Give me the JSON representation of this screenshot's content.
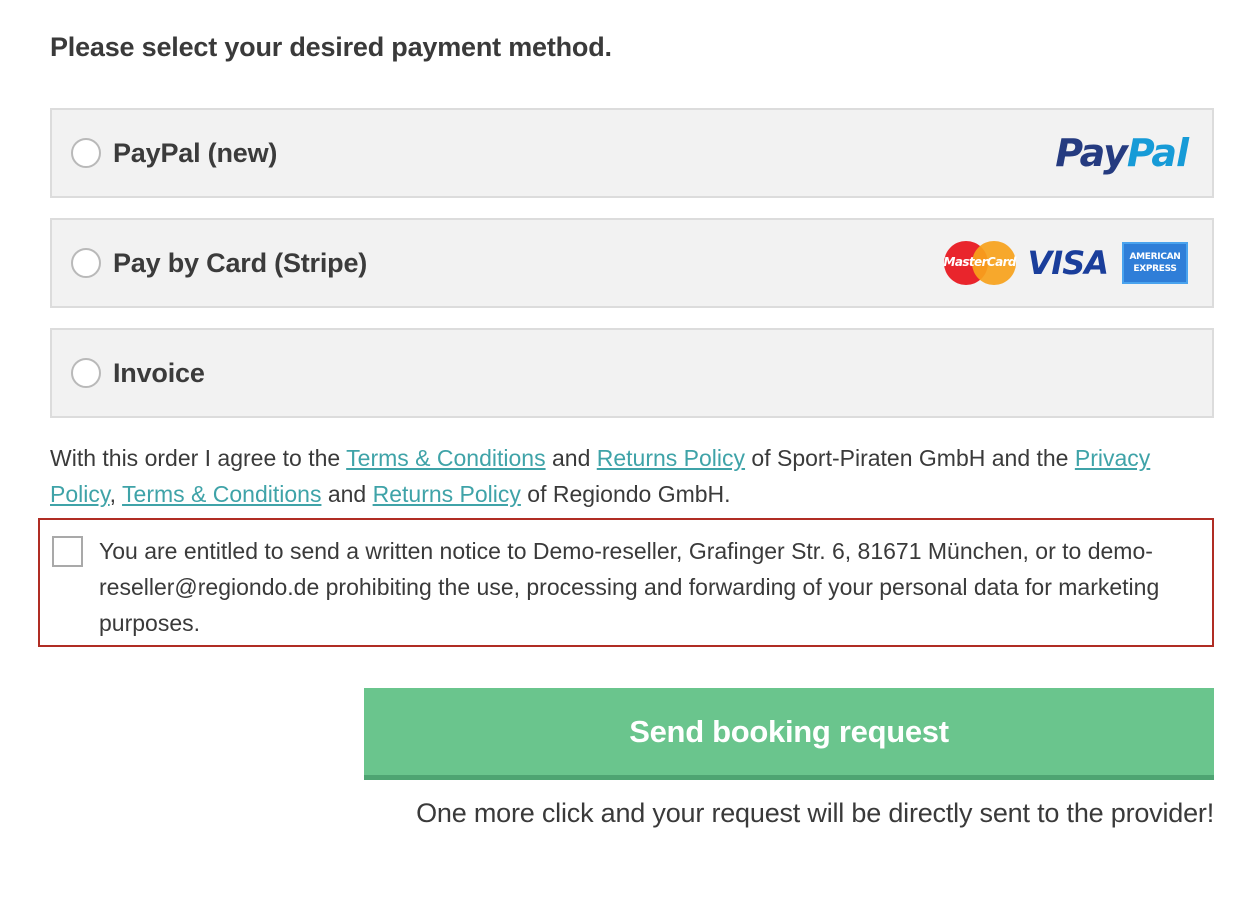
{
  "heading": "Please select your desired payment method.",
  "payment_methods": [
    {
      "label": "PayPal (new)",
      "logo": "paypal-logo",
      "logo_text": [
        "Pay",
        "Pal"
      ]
    },
    {
      "label": "Pay by Card (Stripe)",
      "logos": [
        "mastercard-logo",
        "visa-logo",
        "amex-logo"
      ],
      "mastercard_text": "MasterCard",
      "visa_text": "VISA",
      "amex_text": [
        "AMERICAN",
        "EXPRESS"
      ]
    },
    {
      "label": "Invoice"
    }
  ],
  "terms": {
    "part1": "With this order I agree to the ",
    "link1": "Terms & Conditions",
    "part2": " and ",
    "link2": "Returns Policy",
    "part3": " of Sport-Piraten GmbH and the ",
    "link3": "Privacy Policy",
    "part4": ", ",
    "link4": "Terms & Conditions",
    "part5": " and ",
    "link5": "Returns Policy",
    "part6": " of Regiondo GmbH."
  },
  "consent": {
    "text": "You are entitled to send a written notice to Demo-reseller, Grafinger Str. 6, 81671 München, or to demo-reseller@regiondo.de prohibiting the use, processing and forwarding of your personal data for marketing purposes.",
    "checked": false
  },
  "submit_label": "Send booking request",
  "hint": "One more click and your request will be directly sent to the provider!",
  "colors": {
    "accent_green": "#6ac58d",
    "link_teal": "#3fa3a8",
    "error_border": "#b02d24"
  }
}
